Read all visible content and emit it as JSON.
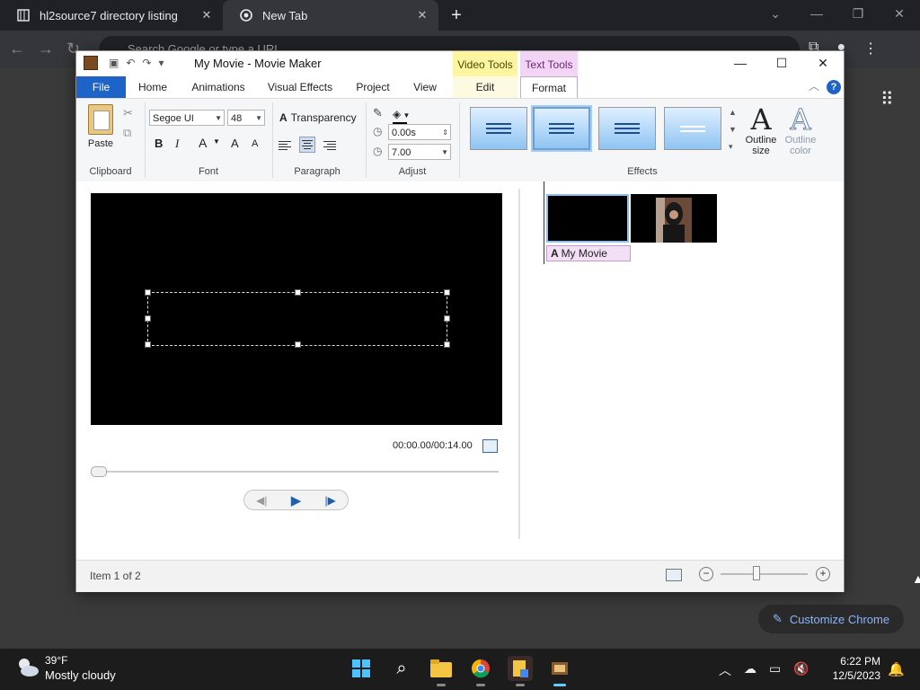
{
  "chrome": {
    "tabs": [
      {
        "title": "hl2source7 directory listing"
      },
      {
        "title": "New Tab"
      }
    ],
    "new_tab": "+",
    "omnibox_placeholder": "Search Google or type a URL",
    "customize_label": "Customize Chrome"
  },
  "window": {
    "title": "My Movie - Movie Maker",
    "context_video": "Video Tools",
    "context_text": "Text Tools",
    "help": "?"
  },
  "ribbon": {
    "tabs": [
      "File",
      "Home",
      "Animations",
      "Visual Effects",
      "Project",
      "View",
      "Edit",
      "Format"
    ],
    "active_tab": "Format",
    "paste_label": "Paste",
    "font_family": "Segoe UI",
    "font_size": "48",
    "bold": "B",
    "italic": "I",
    "font_color": "A",
    "grow": "A",
    "shrink": "A",
    "transparency_label": "Transparency",
    "start_time": "0.00s",
    "duration": "7.00",
    "outline_size_label": "Outline size",
    "outline_color_label": "Outline color",
    "groups": {
      "clipboard": "Clipboard",
      "font": "Font",
      "paragraph": "Paragraph",
      "adjust": "Adjust",
      "effects": "Effects"
    }
  },
  "preview": {
    "time": "00:00.00/00:14.00",
    "seek_position": 0
  },
  "storyboard": {
    "caption": "My Movie"
  },
  "status": {
    "item_text": "Item 1 of 2",
    "zoom_level": 0.4
  },
  "taskbar": {
    "temperature": "39°F",
    "weather": "Mostly cloudy",
    "time": "6:22 PM",
    "date": "12/5/2023"
  },
  "colors": {
    "file_tab": "#1e64c8",
    "video_tools": "#fdf5a0",
    "text_tools": "#f2d5f5",
    "accent": "#60cdff"
  }
}
